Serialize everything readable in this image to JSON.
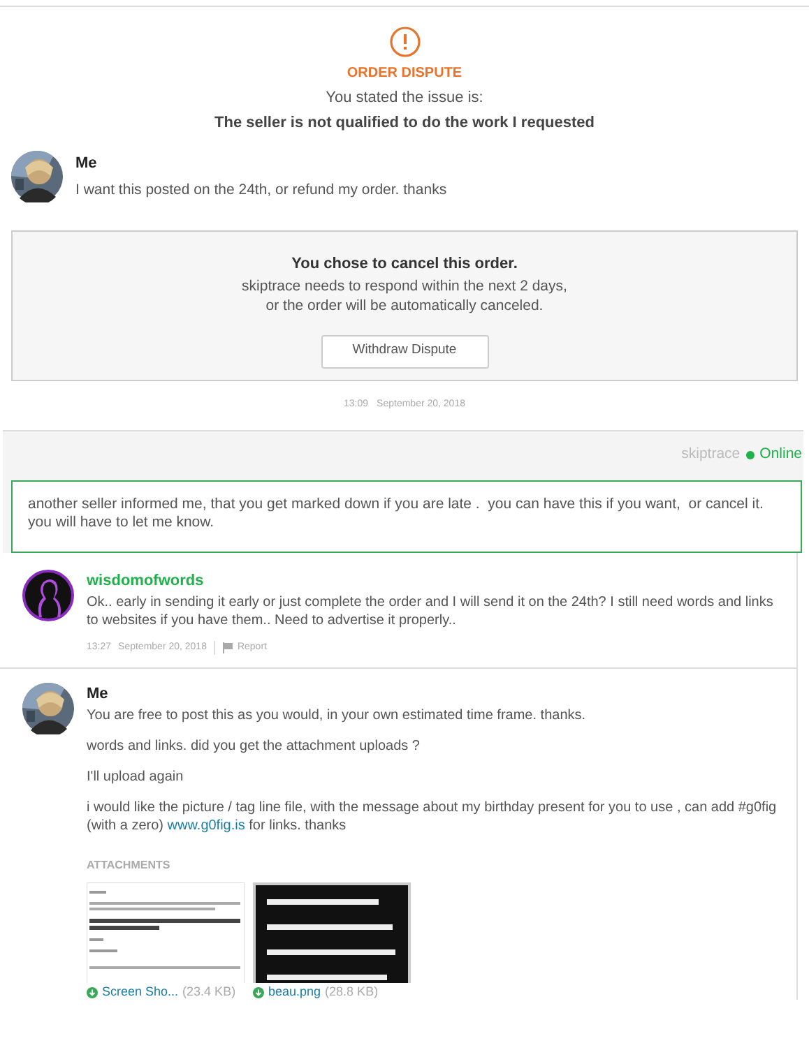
{
  "dispute": {
    "title": "ORDER DISPUTE",
    "intro": "You stated the issue is:",
    "issue": "The seller is not qualified to do the work I requested"
  },
  "top_message": {
    "author": "Me",
    "text": "I want this posted on the 24th, or refund my order. thanks"
  },
  "cancel_notice": {
    "title": "You chose to cancel this order.",
    "lines": [
      "skiptrace needs to respond within the next 2 days,",
      "or the order will be automatically canceled."
    ],
    "button": "Withdraw Dispute"
  },
  "timestamp": {
    "time": "13:09",
    "date": "September 20, 2018"
  },
  "chat_header": {
    "user": "skiptrace",
    "status": "Online",
    "online": true
  },
  "compose": {
    "value": "another seller informed me, that you get marked down if you are late .  you can have this if you want,  or cancel it. you will have to let me know. "
  },
  "messages": [
    {
      "kind": "seller",
      "author": "wisdomofwords",
      "paragraphs": [
        [
          {
            "text": "Ok.. early in sending it early or just complete the order and I will send it on the 24th? I still need words and links to websites if you have them.. Need to advertise it properly.."
          }
        ]
      ],
      "time": "13:27",
      "date": "September 20, 2018",
      "report": "Report"
    },
    {
      "kind": "buyer",
      "author": "Me",
      "paragraphs": [
        [
          {
            "text": "You are free to post this as you would, in your own estimated time frame. thanks."
          }
        ],
        [
          {
            "text": "words and links. did you get the attachment uploads ?"
          }
        ],
        [
          {
            "text": "I'll upload again"
          }
        ],
        [
          {
            "text": "i would like the picture / tag line file, with the message about my birthday present for you to use , can add #g0fig (with a zero) "
          },
          {
            "text": "www.g0fig.is",
            "link": true
          },
          {
            "text": " for links. thanks"
          }
        ]
      ],
      "attachments": {
        "label": "ATTACHMENTS",
        "files": [
          {
            "kind": "document",
            "name": "Screen Sho...",
            "size": "(23.4 KB)"
          },
          {
            "kind": "dark",
            "name": "beau.png",
            "size": "(28.8 KB)"
          }
        ]
      }
    }
  ]
}
